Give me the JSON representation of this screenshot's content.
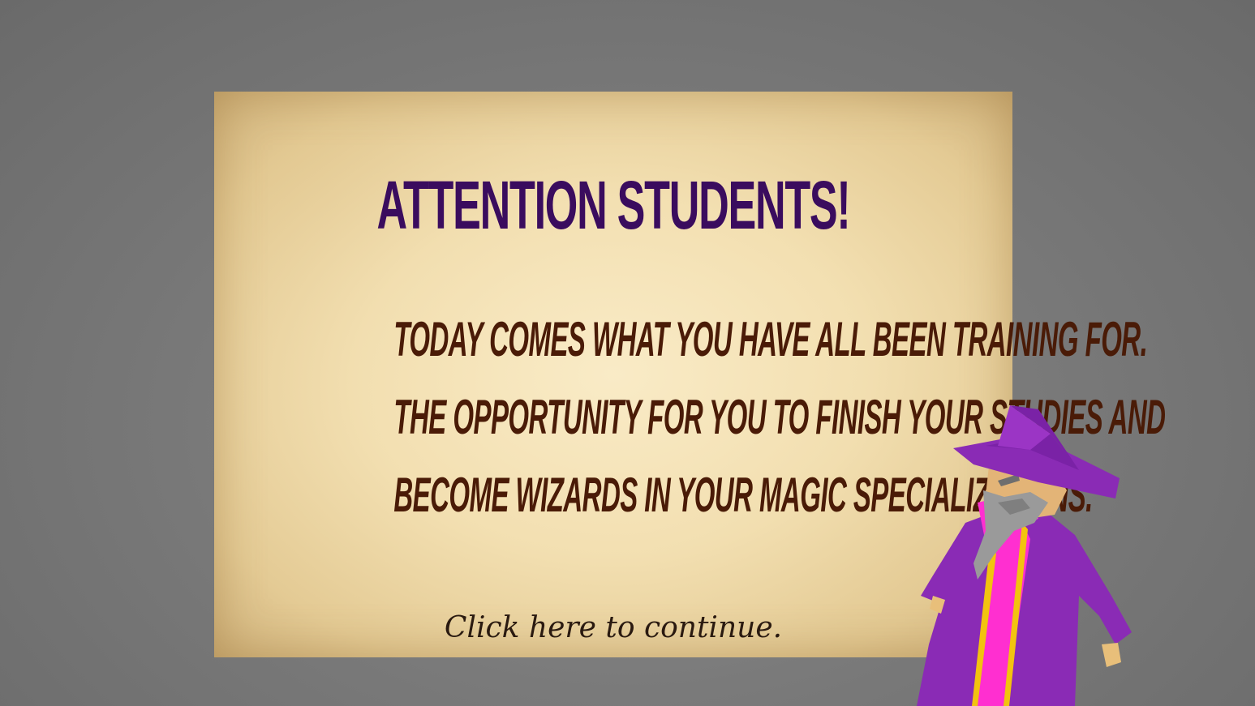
{
  "notice": {
    "title": "ATTENTION STUDENTS!",
    "lines": [
      "TODAY COMES WHAT YOU HAVE ALL BEEN TRAINING FOR.",
      "THE OPPORTUNITY FOR YOU TO FINISH YOUR STUDIES AND",
      "BECOME WIZARDS IN YOUR MAGIC SPECIALIZATIONS."
    ],
    "continue_label": "Click here to continue."
  },
  "colors": {
    "background": "#7a7a7a",
    "parchment": "#efd9a8",
    "title": "#3a0c5e",
    "body_text": "#4a1b07",
    "continue_text": "#2a1a10",
    "wizard_robe": "#8a2bb5",
    "wizard_trim": "#ff2fd0"
  },
  "icons": {
    "character": "wizard-character-icon"
  }
}
